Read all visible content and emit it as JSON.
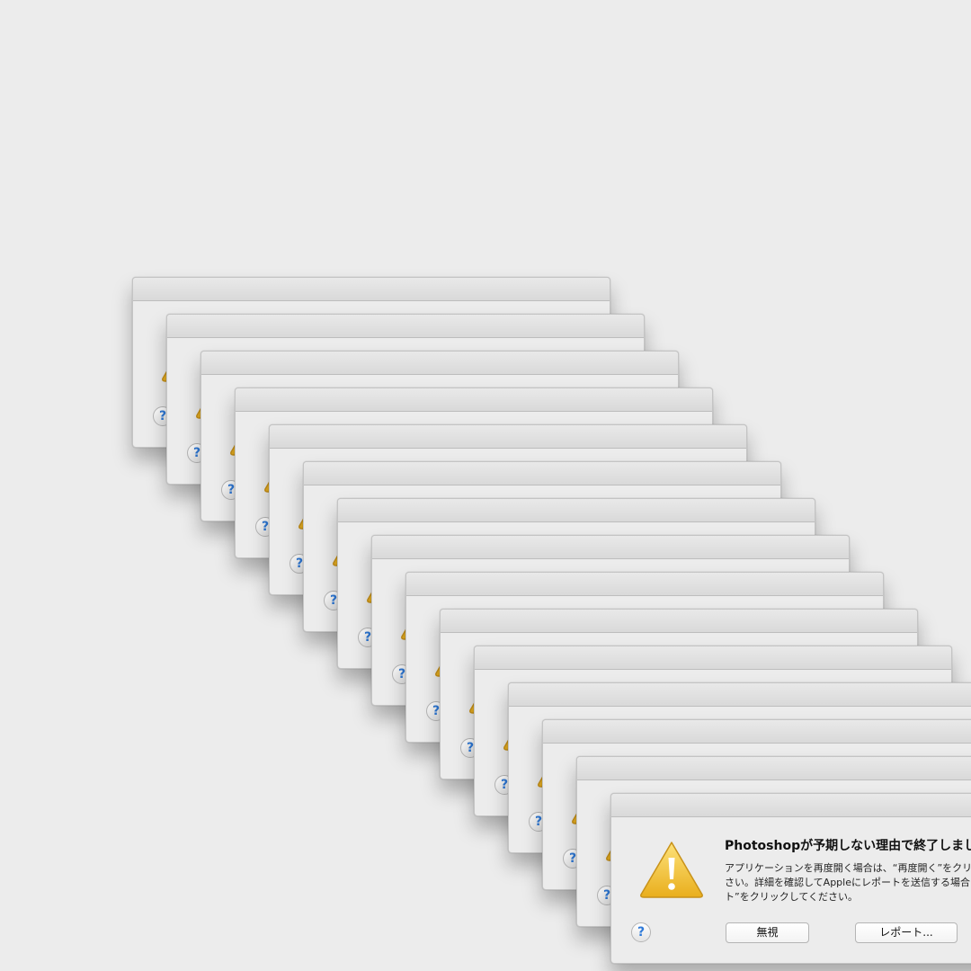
{
  "dialog": {
    "title": "Photoshopが予期しない理由で終了しました",
    "message_lines": [
      "アプリケーションを再度開く場合は、“再度開く”をクリックしてくだ",
      "さい。詳細を確認してAppleにレポートを送信する場合は、“レポー",
      "ト”をクリックしてください。"
    ],
    "help_label": "?",
    "ignore_label": "無視",
    "report_label": "レポート..."
  },
  "stack_count": 15,
  "icons": {
    "warning": "warning-triangle-icon",
    "help": "help-icon"
  },
  "colors": {
    "background": "#ececec",
    "warning_yellow": "#f2c230",
    "help_blue": "#2f7ad9"
  }
}
